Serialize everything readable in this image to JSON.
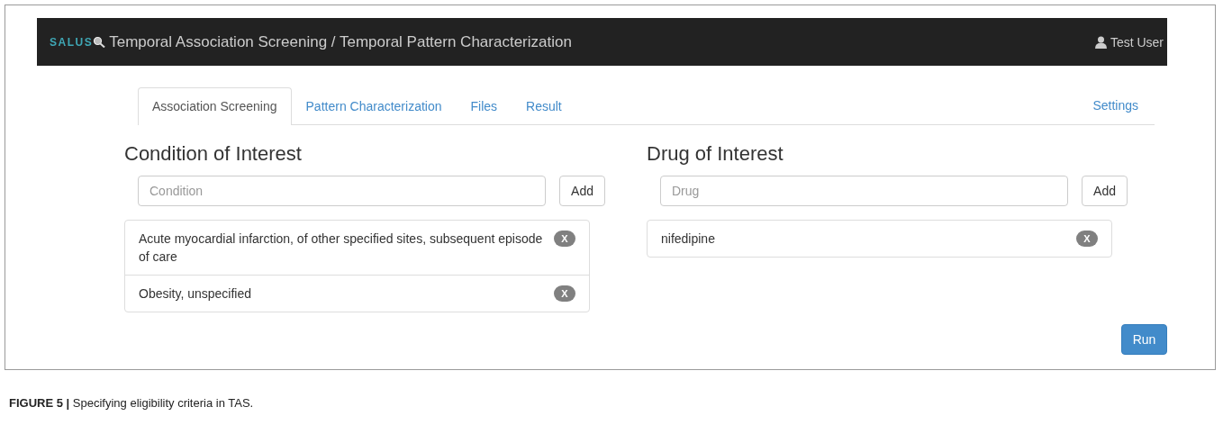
{
  "navbar": {
    "brand": "SALUS",
    "title": "Temporal Association Screening / Temporal Pattern Characterization",
    "user": "Test User"
  },
  "tabs": [
    {
      "label": "Association Screening",
      "selected": true
    },
    {
      "label": "Pattern Characterization",
      "selected": false
    },
    {
      "label": "Files",
      "selected": false
    },
    {
      "label": "Result",
      "selected": false
    }
  ],
  "settings_link": "Settings",
  "panels": [
    {
      "heading": "Condition of Interest",
      "placeholder": "Condition",
      "add_button": "Add",
      "items": [
        {
          "label": "Acute myocardial infarction, of other specified sites, subsequent episode of care",
          "remove": "X"
        },
        {
          "label": "Obesity, unspecified",
          "remove": "X"
        }
      ]
    },
    {
      "heading": "Drug of Interest",
      "placeholder": "Drug",
      "add_button": "Add",
      "items": [
        {
          "label": "nifedipine",
          "remove": "X"
        }
      ]
    }
  ],
  "run_button": "Run",
  "caption": "**FIGURE 5 |** Specifying eligibility criteria in TAS."
}
